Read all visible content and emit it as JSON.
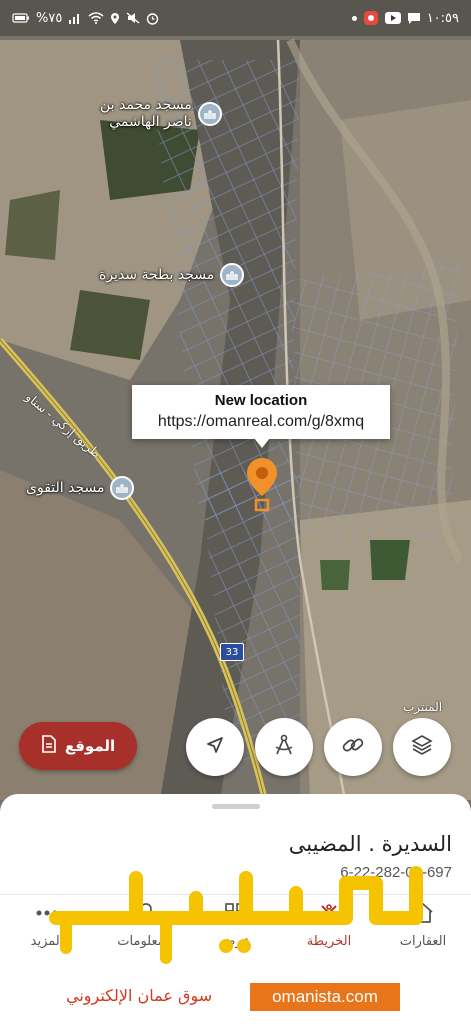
{
  "status_bar": {
    "battery": "%٧٥",
    "time": "١٠:٥٩"
  },
  "map": {
    "pois": [
      {
        "name": "مسجد محمد بن ناصر الهاشمي",
        "line1": "مسجد محمد بن",
        "line2": "ناصر الهاشمي",
        "icon": "mosque-icon"
      },
      {
        "name": "مسجد بطحة سديرة",
        "line1": "مسجد بطحة سديرة",
        "icon": "mosque-icon"
      },
      {
        "name": "مسجد التقوى",
        "line1": "مسجد التقوى",
        "icon": "mosque-icon"
      }
    ],
    "road_name": "طريق إزكي - سناو",
    "road_shield": "33",
    "nearby_label": "المنترب",
    "popup": {
      "title": "New location",
      "url": "https://omanreal.com/g/8xmq"
    },
    "pin_color": "#f0912a"
  },
  "controls": {
    "location_button": {
      "label": "الموقع",
      "icon": "document-icon",
      "color": "#a8302a"
    },
    "round_buttons": [
      {
        "name": "navigate-icon"
      },
      {
        "name": "measure-icon"
      },
      {
        "name": "link-icon"
      },
      {
        "name": "layers-icon"
      }
    ]
  },
  "sheet": {
    "title": "السديرة . المضيبى",
    "code": "6-22-282-01-697",
    "tabs": [
      {
        "label": "المزيد",
        "icon": "more-icon"
      },
      {
        "label": "معلومات",
        "icon": "heart-icon"
      },
      {
        "label": "عرض",
        "icon": "grid-icon"
      },
      {
        "label": "الخريطة",
        "icon": "map-icon"
      },
      {
        "label": "العقارات",
        "icon": "home-icon"
      }
    ]
  },
  "watermark": {
    "logo_text": "عمانيستا",
    "domain": "omanista.com",
    "subtitle": "سوق عمان الإلكتروني",
    "colors": {
      "logo": "#f5c300",
      "domain_bg": "#e8751a",
      "subtitle": "#d43a1e"
    }
  }
}
